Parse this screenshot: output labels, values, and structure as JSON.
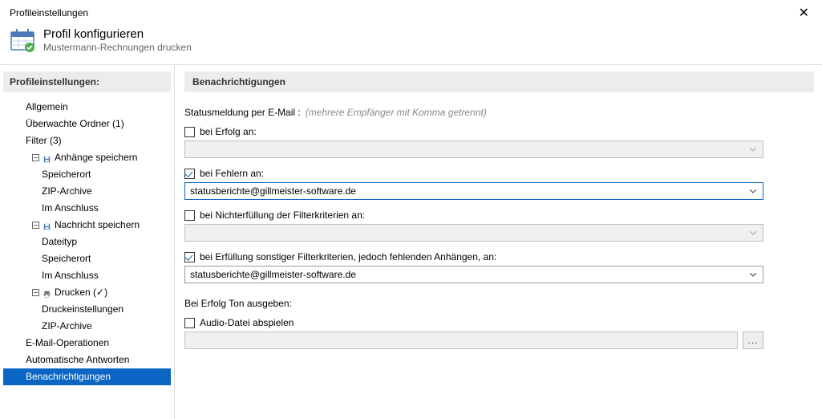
{
  "window": {
    "title": "Profileinstellungen"
  },
  "header": {
    "title": "Profil konfigurieren",
    "subtitle": "Mustermann-Rechnungen drucken"
  },
  "sidebar": {
    "header": "Profileinstellungen:",
    "items": [
      {
        "label": "Allgemein",
        "level": 1
      },
      {
        "label": "Überwachte Ordner (1)",
        "level": 1
      },
      {
        "label": "Filter (3)",
        "level": 1
      },
      {
        "label": "Anhänge speichern",
        "level": 2,
        "icon": "save"
      },
      {
        "label": "Speicherort",
        "level": 3
      },
      {
        "label": "ZIP-Archive",
        "level": 3
      },
      {
        "label": "Im Anschluss",
        "level": 3
      },
      {
        "label": "Nachricht speichern",
        "level": 2,
        "icon": "save"
      },
      {
        "label": "Dateityp",
        "level": 3
      },
      {
        "label": "Speicherort",
        "level": 3
      },
      {
        "label": "Im Anschluss",
        "level": 3
      },
      {
        "label": "Drucken (✓)",
        "level": 2,
        "icon": "print"
      },
      {
        "label": "Druckeinstellungen",
        "level": 3
      },
      {
        "label": "ZIP-Archive",
        "level": 3
      },
      {
        "label": "E-Mail-Operationen",
        "level": 1
      },
      {
        "label": "Automatische Antworten",
        "level": 1
      },
      {
        "label": "Benachrichtigungen",
        "level": 1,
        "selected": true
      }
    ]
  },
  "content": {
    "sectionTitle": "Benachrichtigungen",
    "group": {
      "label": "Statusmeldung per E-Mail :",
      "hint": "(mehrere Empfänger mit Komma getrennt)"
    },
    "fields": [
      {
        "label": "bei Erfolg an:",
        "checked": false,
        "value": "",
        "disabled": true
      },
      {
        "label": "bei Fehlern an:",
        "checked": true,
        "value": "statusberichte@gillmeister-software.de",
        "focused": true
      },
      {
        "label": "bei Nichterfüllung der Filterkriterien an:",
        "checked": false,
        "value": "",
        "disabled": true
      },
      {
        "label": "bei Erfüllung sonstiger Filterkriterien, jedoch fehlenden Anhängen, an:",
        "checked": true,
        "value": "statusberichte@gillmeister-software.de"
      }
    ],
    "sound": {
      "label": "Bei Erfolg Ton ausgeben:",
      "checkbox": "Audio-Datei abspielen",
      "checked": false,
      "button": "..."
    }
  }
}
